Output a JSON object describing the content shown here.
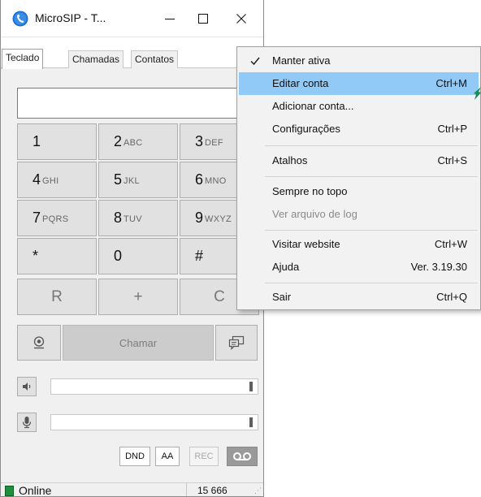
{
  "window": {
    "title": "MicroSIP - T...",
    "tabs": [
      {
        "label": "Teclado",
        "active": true
      },
      {
        "label": "Chamadas",
        "active": false
      },
      {
        "label": "Contatos",
        "active": false
      }
    ]
  },
  "dialpad": {
    "number_value": "",
    "keys": [
      {
        "digit": "1",
        "letters": ""
      },
      {
        "digit": "2",
        "letters": "ABC"
      },
      {
        "digit": "3",
        "letters": "DEF"
      },
      {
        "digit": "4",
        "letters": "GHI"
      },
      {
        "digit": "5",
        "letters": "JKL"
      },
      {
        "digit": "6",
        "letters": "MNO"
      },
      {
        "digit": "7",
        "letters": "PQRS"
      },
      {
        "digit": "8",
        "letters": "TUV"
      },
      {
        "digit": "9",
        "letters": "WXYZ"
      },
      {
        "digit": "*",
        "letters": ""
      },
      {
        "digit": "0",
        "letters": ""
      },
      {
        "digit": "#",
        "letters": ""
      }
    ],
    "redial_label": "R",
    "plus_label": "+",
    "clear_label": "C"
  },
  "actions": {
    "call_label": "Chamar"
  },
  "controls": {
    "dnd_label": "DND",
    "aa_label": "AA",
    "rec_label": "REC",
    "voicemail_icon": "voicemail-icon"
  },
  "audio": {
    "speaker_icon": "speaker-icon",
    "mic_icon": "microphone-icon"
  },
  "status": {
    "state": "Online",
    "count": "15 666",
    "indicator_color": "#1e8f3a"
  },
  "menu": {
    "items": [
      {
        "label": "Manter ativa",
        "shortcut": "",
        "checked": true
      },
      {
        "label": "Editar conta",
        "shortcut": "Ctrl+M",
        "highlighted": true
      },
      {
        "label": "Adicionar conta...",
        "shortcut": ""
      },
      {
        "label": "Configurações",
        "shortcut": "Ctrl+P"
      },
      {
        "label": "Atalhos",
        "shortcut": "Ctrl+S"
      },
      {
        "label": "Sempre no topo",
        "shortcut": ""
      },
      {
        "label": "Ver arquivo de log",
        "shortcut": "",
        "disabled": true
      },
      {
        "label": "Visitar website",
        "shortcut": "Ctrl+W"
      },
      {
        "label": "Ajuda",
        "shortcut": "Ver. 3.19.30"
      },
      {
        "label": "Sair",
        "shortcut": "Ctrl+Q"
      }
    ]
  },
  "colors": {
    "menu_highlight": "#91c9f7",
    "call_button": "#cccccc",
    "accent_blue": "#1e6fd6"
  }
}
